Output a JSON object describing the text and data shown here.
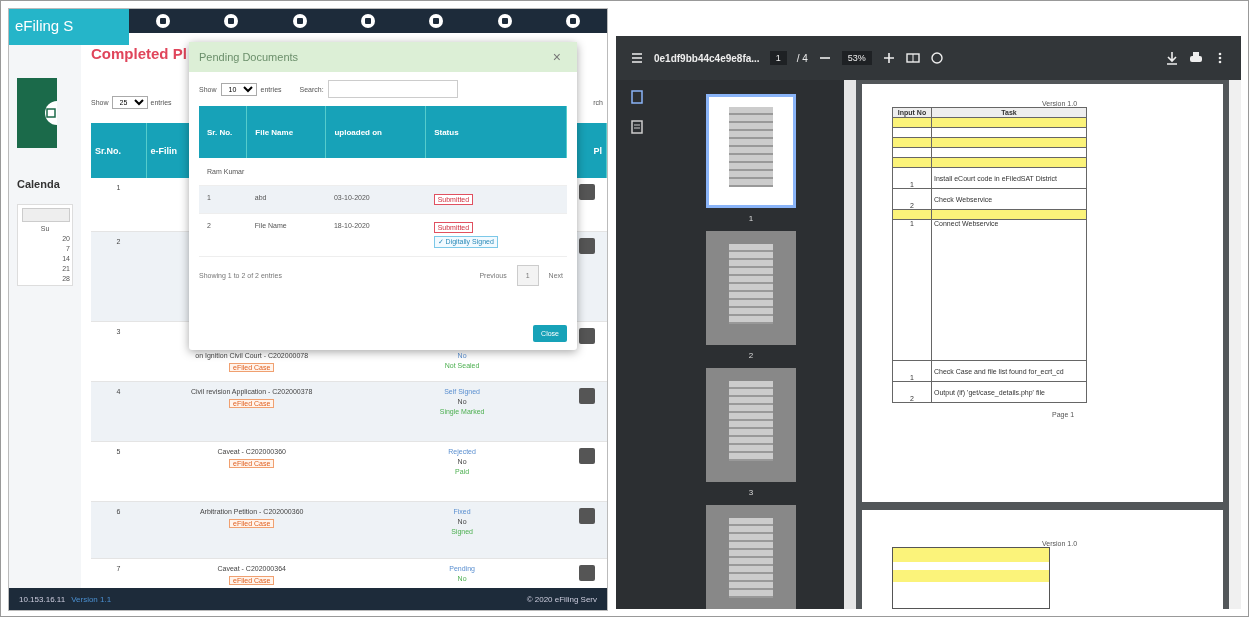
{
  "app": {
    "brand": "eFiling S",
    "title": "Completed Pl",
    "show": {
      "label": "Show",
      "value": "25",
      "suffix": "entries"
    },
    "search_label": "rch",
    "columns": [
      {
        "label": "Sr.No."
      },
      {
        "label": "e-Filin"
      },
      {},
      {
        "label": "Pl"
      }
    ],
    "rows": [
      {
        "sr": "1"
      },
      {
        "sr": "2"
      },
      {
        "sr": "3",
        "lines": [
          "on Ignition Civil Court - C202000078"
        ],
        "tag": "eFiled Case",
        "status": [
          "No",
          "Not Sealed"
        ]
      },
      {
        "sr": "4",
        "lines": [
          "Civil revision Application - C202000378"
        ],
        "tag": "eFiled Case",
        "status": [
          "Self Signed",
          "No",
          "Single Marked"
        ]
      },
      {
        "sr": "5",
        "lines": [
          "Caveat - C202000360"
        ],
        "tag": "eFiled Case",
        "status": [
          "Rejected",
          "No",
          "Paid"
        ]
      },
      {
        "sr": "6",
        "lines": [
          "Arbitration Petition - C202000360"
        ],
        "tag": "eFiled Case",
        "status": [
          "Fixed",
          "No",
          "Signed"
        ]
      },
      {
        "sr": "7",
        "lines": [
          "Caveat - C202000364"
        ],
        "tag": "eFiled Case",
        "status": [
          "Pending",
          "No"
        ]
      }
    ],
    "calendar": {
      "title": "Calenda",
      "day_header": "Su",
      "days": [
        "20",
        "7",
        "14",
        "21",
        "28"
      ]
    },
    "footer": {
      "ip": "10.153.16.11",
      "version": "Version 1.1",
      "copyright": "© 2020 eFiling Serv"
    }
  },
  "modal": {
    "title": "Pending Documents",
    "close": "×",
    "show": {
      "label": "Show",
      "value": "10",
      "suffix": "entries"
    },
    "search_label": "Search:",
    "columns": [
      "Sr. No.",
      "File Name",
      "uploaded on",
      "Status"
    ],
    "group": "Ram Kumar",
    "rows": [
      {
        "sr": "1",
        "file": "abd",
        "date": "03-10-2020",
        "badges": [
          {
            "kind": "submitted",
            "text": "Submitted"
          }
        ]
      },
      {
        "sr": "2",
        "file": "File Name",
        "date": "18-10-2020",
        "badges": [
          {
            "kind": "submitted",
            "text": "Submitted"
          },
          {
            "kind": "signed",
            "text": "✓ Digitally Signed"
          }
        ]
      }
    ],
    "info": "Showing 1 to 2 of 2 entries",
    "pagination": [
      {
        "label": "Previous",
        "selected": false
      },
      {
        "label": "1",
        "selected": true
      },
      {
        "label": "Next",
        "selected": false
      }
    ],
    "button": "Close"
  },
  "pdf": {
    "filename": "0e1df9bb44c4e9e8fa...",
    "page": "1",
    "pages": "/ 4",
    "zoom": "53%",
    "thumbnails": [
      {
        "label": "1",
        "selected": true
      },
      {
        "label": "2",
        "selected": false
      },
      {
        "label": "3",
        "selected": false
      },
      {
        "selected": false
      }
    ],
    "page_doc": {
      "version": "Version 1.0",
      "columns": [
        "Input No",
        "Task"
      ],
      "rows": [
        {
          "kind": "yellow"
        },
        {
          "kind": "plain"
        },
        {
          "kind": "yellow"
        },
        {
          "kind": "plain"
        },
        {
          "kind": "yellow"
        },
        {
          "kind": "text",
          "no": "1",
          "task": "Install eCourt code in eFiledSAT District"
        },
        {
          "kind": "text",
          "no": "2",
          "task": "Check Webservice"
        },
        {
          "kind": "yellow"
        },
        {
          "kind": "tall",
          "no": "1",
          "task": "Connect Webservice"
        },
        {
          "kind": "text",
          "no": "1",
          "task": "Check Case and file list found for_ecrt_cd"
        },
        {
          "kind": "text",
          "no": "2",
          "task": "Output (if) 'get/case_details.php' file"
        }
      ],
      "footer": "Page 1"
    },
    "page_doc2": {
      "version": "Version 1.0"
    }
  }
}
